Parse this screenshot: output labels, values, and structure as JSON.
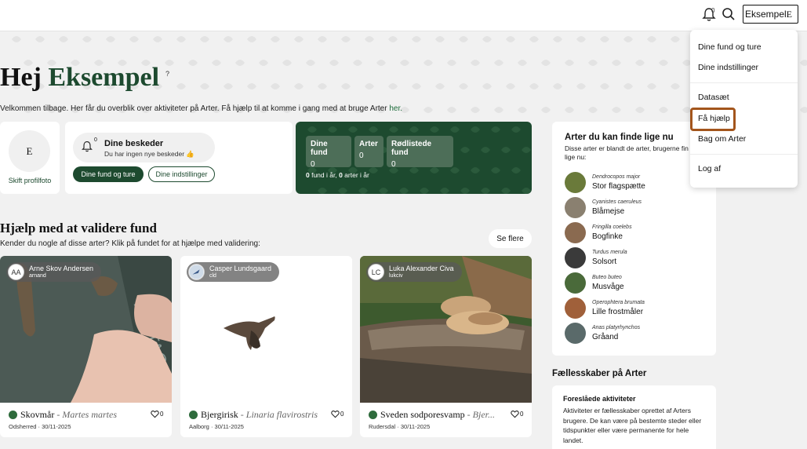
{
  "topbar": {
    "notification_count": "0",
    "user_label": "Eksempel",
    "user_initial": "E"
  },
  "greeting": {
    "hello": "Hej",
    "name": "Eksempel",
    "help_mark": "?",
    "welcome_text": "Velkommen tilbage. Her får du overblik over aktiviteter på Arter. Få hjælp til at komme i gang med at bruge Arter",
    "welcome_link": "her."
  },
  "profile": {
    "initial": "E",
    "change_photo": "Skift profilfoto"
  },
  "messages": {
    "count": "0",
    "title": "Dine beskeder",
    "subtitle": "Du har ingen nye beskeder 👍",
    "btn_finds": "Dine fund og ture",
    "btn_settings": "Dine indstillinger"
  },
  "stats": {
    "boxes": [
      {
        "label": "Dine fund",
        "value": "0"
      },
      {
        "label": "Arter",
        "value": "0"
      },
      {
        "label": "Rødlistede fund",
        "value": "0"
      }
    ],
    "footer_a": "0",
    "footer_b": " fund i år, ",
    "footer_c": "0",
    "footer_d": " arter i år"
  },
  "validate": {
    "title": "Hjælp med at validere fund",
    "subtitle": "Kender du nogle af disse arter? Klik på fundet for at hjælpe med validering:",
    "see_more": "Se flere",
    "cards": [
      {
        "initials": "AA",
        "user": "Arne Skov Andersen",
        "username": "arnand",
        "species": "Skovmår",
        "latin": "Martes martes",
        "likes": "0",
        "place": "Odsherred",
        "date": "30/11-2025"
      },
      {
        "initials": "",
        "user": "Casper Lundsgaard",
        "username": "cld",
        "species": "Bjergirisk",
        "latin": "Linaria flavirostris",
        "likes": "0",
        "place": "Aalborg",
        "date": "30/11-2025"
      },
      {
        "initials": "LC",
        "user": "Luka Alexander Civa",
        "username": "lukciv",
        "species": "Sveden sodporesvamp",
        "latin": "Bjer...",
        "likes": "0",
        "place": "Rudersdal",
        "date": "30/11-2025"
      }
    ]
  },
  "arter": {
    "title": "Arter du kan finde lige nu",
    "subtitle": "Disse arter er blandt de arter, brugerne fin flest af lige nu:",
    "items": [
      {
        "latin": "Dendrocopos major",
        "danish": "Stor flagspætte",
        "color": "#6a7a3a"
      },
      {
        "latin": "Cyanistes caeruleus",
        "danish": "Blåmejse",
        "color": "#8a8070"
      },
      {
        "latin": "Fringilla coelebs",
        "danish": "Bogfinke",
        "color": "#8a6a50"
      },
      {
        "latin": "Turdus merula",
        "danish": "Solsort",
        "color": "#3a3a3a"
      },
      {
        "latin": "Buteo buteo",
        "danish": "Musvåge",
        "color": "#4a6a3a"
      },
      {
        "latin": "Operophtera brumata",
        "danish": "Lille frostmåler",
        "color": "#a0603a"
      },
      {
        "latin": "Anas platyrhynchos",
        "danish": "Gråand",
        "color": "#5a6a6a"
      }
    ]
  },
  "faelles": {
    "title": "Fællesskaber på Arter",
    "card_title": "Foreslåede aktiviteter",
    "card_text": "Aktiviteter er fællesskaber oprettet af Arters brugere. De kan være på bestemte steder eller tidspunkter eller være permanente for hele landet."
  },
  "dropdown": {
    "items": [
      "Dine fund og ture",
      "Dine indstillinger",
      "Datasæt",
      "Få hjælp",
      "Bag om Arter",
      "Log af"
    ]
  },
  "colors": {
    "brand_green": "#1d4a2f",
    "highlight": "#a3551c"
  }
}
